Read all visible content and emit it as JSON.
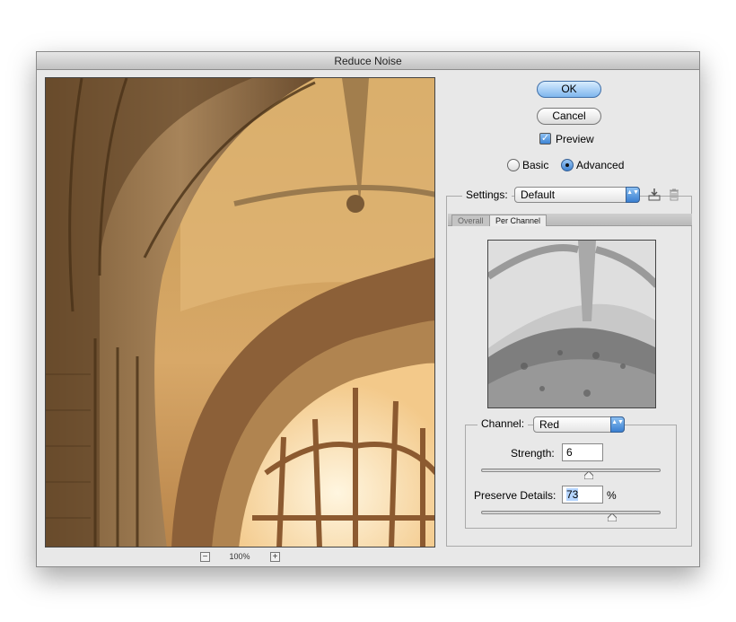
{
  "window": {
    "title": "Reduce Noise"
  },
  "zoom": {
    "value": "100%",
    "minus": "−",
    "plus": "+"
  },
  "buttons": {
    "ok": "OK",
    "cancel": "Cancel"
  },
  "preview_toggle": {
    "label": "Preview",
    "checked": true,
    "mark": "✓"
  },
  "mode": {
    "basic": "Basic",
    "advanced": "Advanced",
    "selected": "Advanced"
  },
  "settings": {
    "label": "Settings:",
    "value": "Default",
    "arrow": "▲▼"
  },
  "icons": {
    "save": "save-settings-icon",
    "delete": "trash-icon"
  },
  "tabs": [
    {
      "label": "Overall",
      "active": false
    },
    {
      "label": "Per Channel",
      "active": true
    }
  ],
  "channel": {
    "label": "Channel:",
    "value": "Red"
  },
  "strength": {
    "label": "Strength:",
    "value": "6",
    "max": 10
  },
  "preserve": {
    "label": "Preserve Details:",
    "value": "73",
    "unit": "%",
    "max": 100
  }
}
